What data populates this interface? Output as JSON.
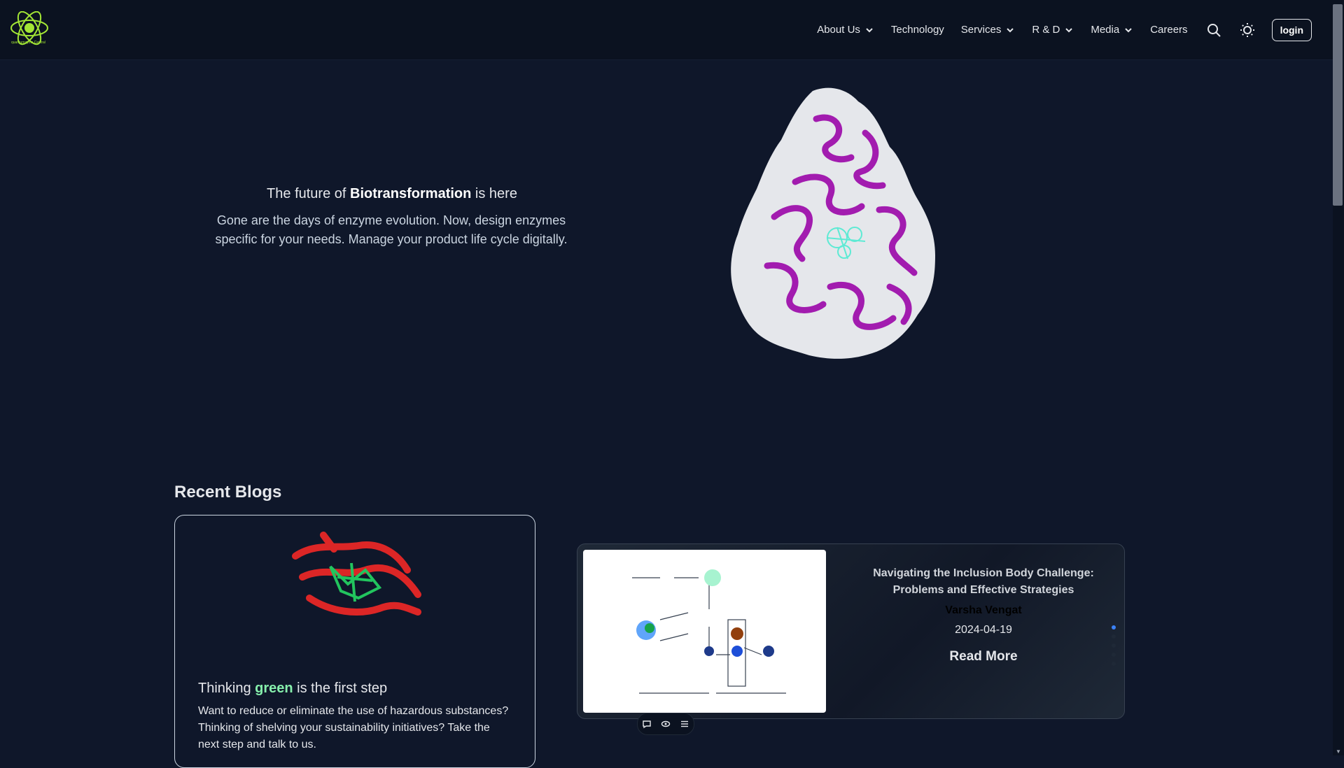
{
  "brand": {
    "name": "quantumzyme",
    "logo_text": "quantumzyme Central"
  },
  "nav": {
    "items": [
      {
        "label": "About Us",
        "has_dropdown": true
      },
      {
        "label": "Technology",
        "has_dropdown": false
      },
      {
        "label": "Services",
        "has_dropdown": true
      },
      {
        "label": "R & D",
        "has_dropdown": true
      },
      {
        "label": "Media",
        "has_dropdown": true
      },
      {
        "label": "Careers",
        "has_dropdown": false
      }
    ],
    "login_label": "login",
    "icons": [
      "search-icon",
      "sun-icon"
    ]
  },
  "hero": {
    "title_prefix": "The future of ",
    "title_bold": "Biotransformation",
    "title_suffix": " is here",
    "description": "Gone are the days of enzyme evolution. Now, design enzymes specific for your needs. Manage your product life cycle digitally."
  },
  "blogs": {
    "section_title": "Recent Blogs",
    "feature_card": {
      "title_prefix": "Thinking ",
      "title_highlight": "green",
      "title_suffix": " is the first step",
      "description": "Want to reduce or eliminate the use of hazardous substances? Thinking of shelving your sustainability initiatives? Take the next step and talk to us."
    },
    "carousel": {
      "post_title": "Navigating the Inclusion Body Challenge: Problems and Effective Strategies",
      "author": "Varsha Vengat",
      "date": "2024-04-19",
      "read_more": "Read More",
      "dot_count": 5,
      "active_dot": 0
    }
  },
  "colors": {
    "background": "#0f172a",
    "nav_background": "#0b1220",
    "highlight_green": "#86efac",
    "active_dot": "#3b82f6"
  }
}
